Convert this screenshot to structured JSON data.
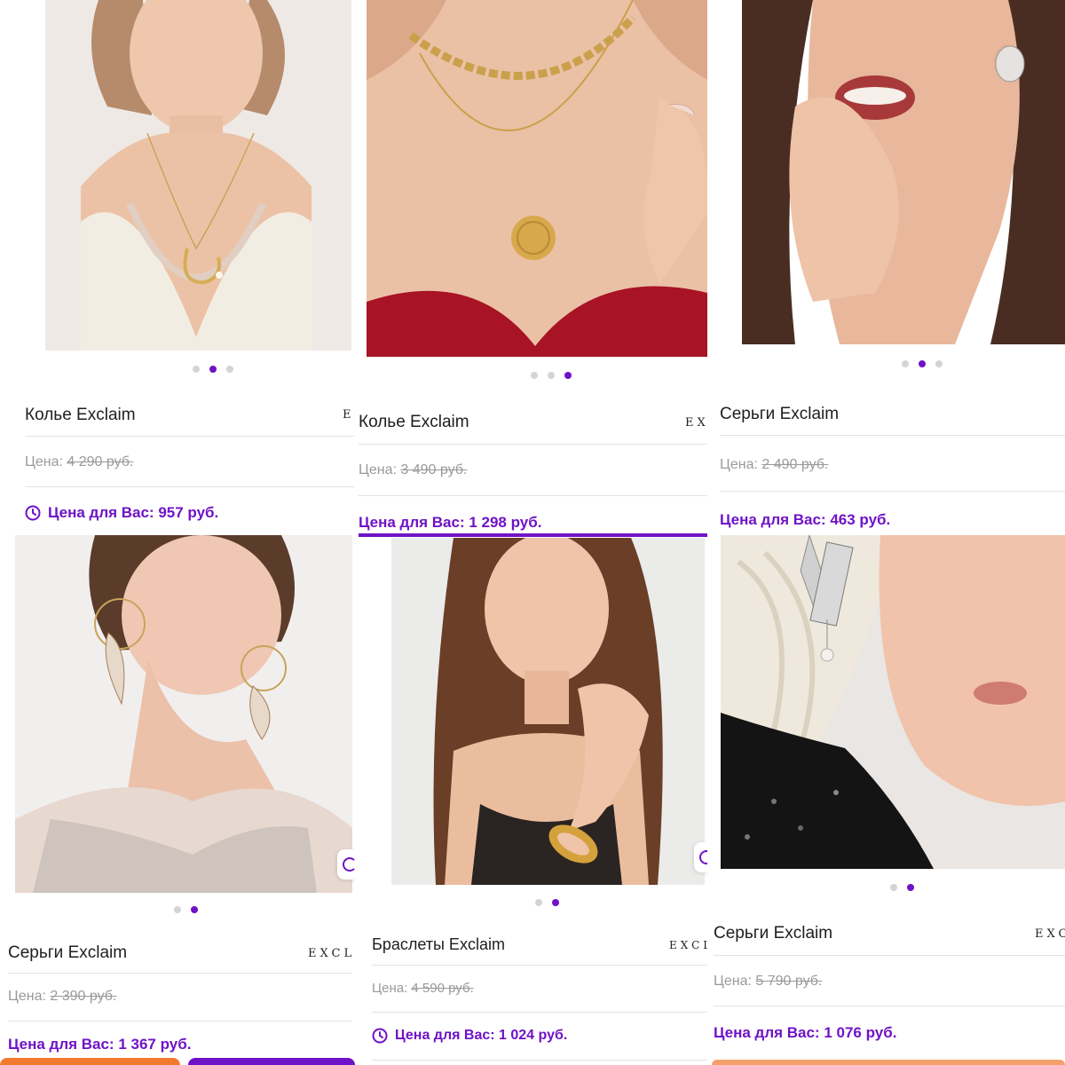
{
  "products": [
    {
      "name": "Колье Exclaim",
      "brand": "E",
      "price_label": "Цена:",
      "old_price": "4 290 руб.",
      "your_price": "Цена для Вас: 957 руб.",
      "dots": 3,
      "active_dot": 1,
      "timer": true,
      "photo": "woman-short-hair-gold-pendant-necklace"
    },
    {
      "name": "Колье Exclaim",
      "brand": "EXC",
      "price_label": "Цена:",
      "old_price": "3 490 руб.",
      "your_price": "Цена для Вас: 1 298 руб.",
      "dots": 3,
      "active_dot": 2,
      "timer": false,
      "photo": "gold-chain-and-coin-necklace"
    },
    {
      "name": "Серьги Exclaim",
      "brand": "",
      "price_label": "Цена:",
      "old_price": "2 490 руб.",
      "your_price": "Цена для Вас: 463 руб.",
      "dots": 3,
      "active_dot": 1,
      "timer": false,
      "photo": "woman-silver-hoop-earring"
    },
    {
      "name": "Серьги Exclaim",
      "brand": "EXCLAi",
      "price_label": "Цена:",
      "old_price": "2 390 руб.",
      "your_price": "Цена для Вас: 1 367 руб.",
      "dots": 2,
      "active_dot": 1,
      "timer": false,
      "photo": "woman-shell-hoop-earrings"
    },
    {
      "name": "Браслеты Exclaim",
      "brand": "EXCLAi",
      "price_label": "Цена:",
      "old_price": "4 590 руб.",
      "your_price": "Цена для Вас: 1 024 руб.",
      "dots": 2,
      "active_dot": 1,
      "timer": true,
      "photo": "woman-gold-bangle-bracelet"
    },
    {
      "name": "Серьги Exclaim",
      "brand": "EXCL",
      "price_label": "Цена:",
      "old_price": "5 790 руб.",
      "your_price": "Цена для Вас: 1 076 руб.",
      "dots": 2,
      "active_dot": 1,
      "timer": false,
      "photo": "blonde-woman-silver-pearl-earring"
    }
  ],
  "colors": {
    "accent": "#6f12c7",
    "muted": "#9a9a9a",
    "orange": "#f27a2e"
  }
}
